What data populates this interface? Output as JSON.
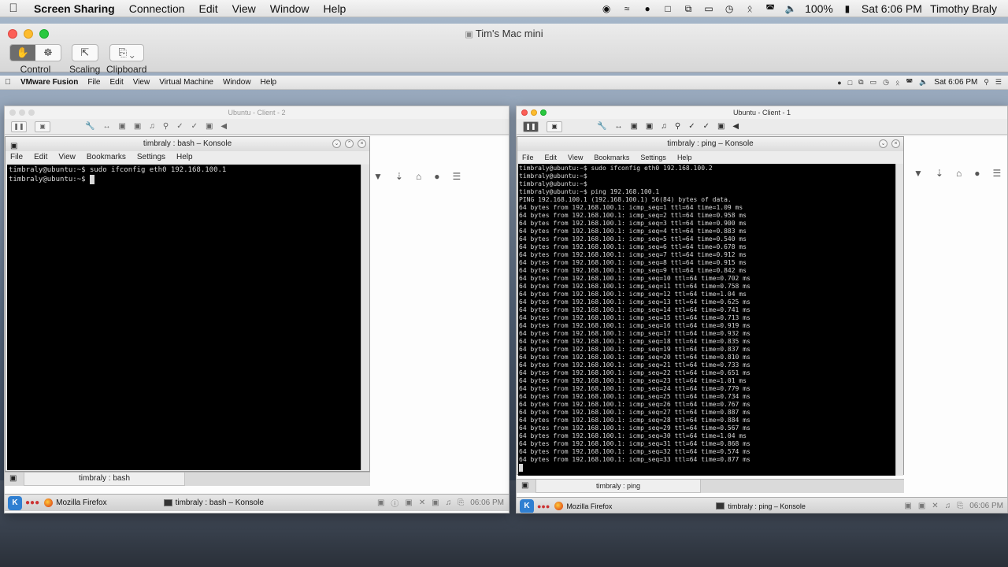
{
  "menubar": {
    "app": "Screen Sharing",
    "items": [
      "Connection",
      "Edit",
      "View",
      "Window",
      "Help"
    ],
    "battery": "100%",
    "clock": "Sat 6:06 PM",
    "user": "Timothy Braly"
  },
  "sharing_window": {
    "title": "Tim's Mac mini",
    "toolbar": {
      "control": "Control",
      "scaling": "Scaling",
      "clipboard": "Clipboard"
    }
  },
  "remote_menubar": {
    "app": "VMware Fusion",
    "items": [
      "File",
      "Edit",
      "View",
      "Virtual Machine",
      "Window",
      "Help"
    ],
    "clock": "Sat 6:06 PM"
  },
  "vm_left": {
    "title": "Ubuntu - Client - 2",
    "konsole": {
      "title": "timbraly : bash – Konsole",
      "menu": [
        "File",
        "Edit",
        "View",
        "Bookmarks",
        "Settings",
        "Help"
      ],
      "lines": [
        "timbraly@ubuntu:~$ sudo ifconfig eth0 192.168.100.1",
        "timbraly@ubuntu:~$ "
      ],
      "tab": "timbraly : bash"
    },
    "panel": {
      "firefox": "Mozilla Firefox",
      "konsole": "timbraly : bash – Konsole",
      "clock": "06:06 PM"
    }
  },
  "vm_right": {
    "title": "Ubuntu - Client - 1",
    "konsole": {
      "title": "timbraly : ping – Konsole",
      "menu": [
        "File",
        "Edit",
        "View",
        "Bookmarks",
        "Settings",
        "Help"
      ],
      "lines": [
        "timbraly@ubuntu:~$ sudo ifconfig eth0 192.168.100.2",
        "timbraly@ubuntu:~$",
        "timbraly@ubuntu:~$",
        "timbraly@ubuntu:~$ ping 192.168.100.1",
        "PING 192.168.100.1 (192.168.100.1) 56(84) bytes of data.",
        "64 bytes from 192.168.100.1: icmp_seq=1 ttl=64 time=1.09 ms",
        "64 bytes from 192.168.100.1: icmp_seq=2 ttl=64 time=0.958 ms",
        "64 bytes from 192.168.100.1: icmp_seq=3 ttl=64 time=0.900 ms",
        "64 bytes from 192.168.100.1: icmp_seq=4 ttl=64 time=0.883 ms",
        "64 bytes from 192.168.100.1: icmp_seq=5 ttl=64 time=0.540 ms",
        "64 bytes from 192.168.100.1: icmp_seq=6 ttl=64 time=0.678 ms",
        "64 bytes from 192.168.100.1: icmp_seq=7 ttl=64 time=0.912 ms",
        "64 bytes from 192.168.100.1: icmp_seq=8 ttl=64 time=0.915 ms",
        "64 bytes from 192.168.100.1: icmp_seq=9 ttl=64 time=0.842 ms",
        "64 bytes from 192.168.100.1: icmp_seq=10 ttl=64 time=0.702 ms",
        "64 bytes from 192.168.100.1: icmp_seq=11 ttl=64 time=0.758 ms",
        "64 bytes from 192.168.100.1: icmp_seq=12 ttl=64 time=1.04 ms",
        "64 bytes from 192.168.100.1: icmp_seq=13 ttl=64 time=0.625 ms",
        "64 bytes from 192.168.100.1: icmp_seq=14 ttl=64 time=0.741 ms",
        "64 bytes from 192.168.100.1: icmp_seq=15 ttl=64 time=0.713 ms",
        "64 bytes from 192.168.100.1: icmp_seq=16 ttl=64 time=0.919 ms",
        "64 bytes from 192.168.100.1: icmp_seq=17 ttl=64 time=0.932 ms",
        "64 bytes from 192.168.100.1: icmp_seq=18 ttl=64 time=0.835 ms",
        "64 bytes from 192.168.100.1: icmp_seq=19 ttl=64 time=0.837 ms",
        "64 bytes from 192.168.100.1: icmp_seq=20 ttl=64 time=0.810 ms",
        "64 bytes from 192.168.100.1: icmp_seq=21 ttl=64 time=0.733 ms",
        "64 bytes from 192.168.100.1: icmp_seq=22 ttl=64 time=0.651 ms",
        "64 bytes from 192.168.100.1: icmp_seq=23 ttl=64 time=1.01 ms",
        "64 bytes from 192.168.100.1: icmp_seq=24 ttl=64 time=0.779 ms",
        "64 bytes from 192.168.100.1: icmp_seq=25 ttl=64 time=0.734 ms",
        "64 bytes from 192.168.100.1: icmp_seq=26 ttl=64 time=0.767 ms",
        "64 bytes from 192.168.100.1: icmp_seq=27 ttl=64 time=0.887 ms",
        "64 bytes from 192.168.100.1: icmp_seq=28 ttl=64 time=0.884 ms",
        "64 bytes from 192.168.100.1: icmp_seq=29 ttl=64 time=0.567 ms",
        "64 bytes from 192.168.100.1: icmp_seq=30 ttl=64 time=1.04 ms",
        "64 bytes from 192.168.100.1: icmp_seq=31 ttl=64 time=0.868 ms",
        "64 bytes from 192.168.100.1: icmp_seq=32 ttl=64 time=0.574 ms",
        "64 bytes from 192.168.100.1: icmp_seq=33 ttl=64 time=0.877 ms"
      ],
      "tab": "timbraly : ping"
    },
    "panel": {
      "firefox": "Mozilla Firefox",
      "konsole": "timbraly : ping – Konsole",
      "clock": "06:06 PM"
    }
  }
}
